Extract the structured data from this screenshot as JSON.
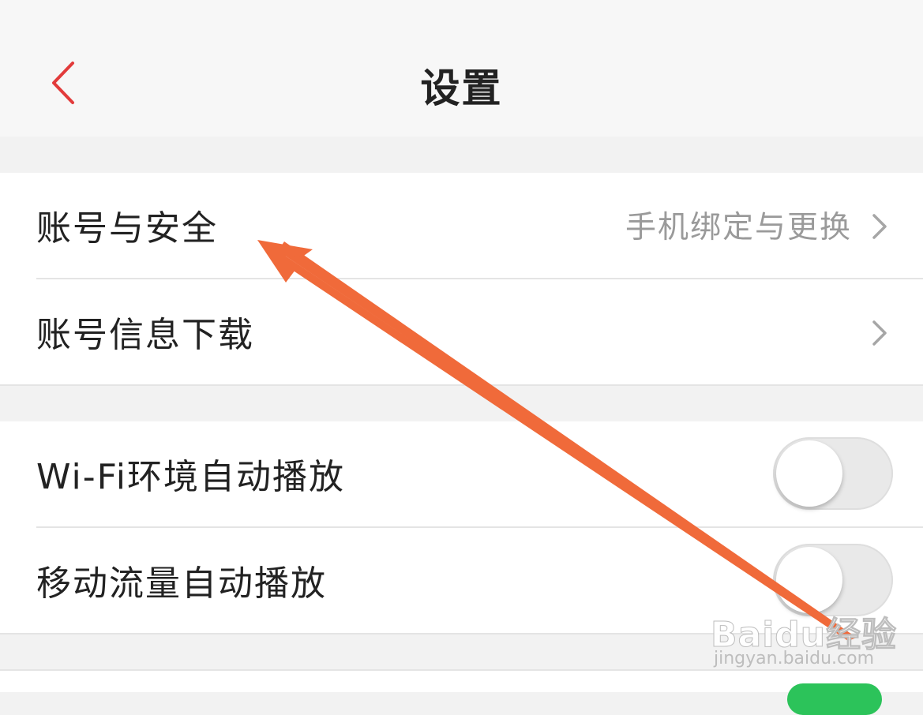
{
  "header": {
    "title": "设置",
    "back_icon": "chevron-left-icon",
    "accent_color": "#e23b3b"
  },
  "groups": [
    {
      "rows": [
        {
          "label": "账号与安全",
          "value": "手机绑定与更换",
          "icon": "chevron-right-icon"
        },
        {
          "label": "账号信息下载",
          "value": "",
          "icon": "chevron-right-icon"
        }
      ]
    },
    {
      "rows": [
        {
          "label": "Wi-Fi环境自动播放",
          "toggle_on": false
        },
        {
          "label": "移动流量自动播放",
          "toggle_on": false
        }
      ]
    }
  ],
  "annotation": {
    "arrow_color": "#f06a3a",
    "arrow_icon": "annotation-arrow"
  },
  "watermark": {
    "logo": "Baidu经验",
    "url": "jingyan.baidu.com"
  }
}
